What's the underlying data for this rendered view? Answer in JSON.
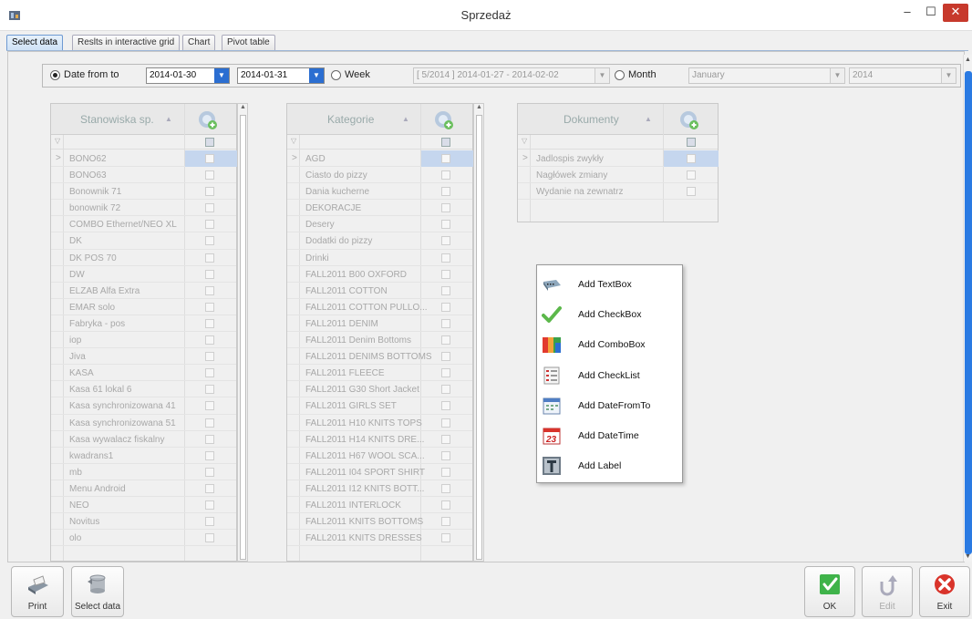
{
  "window": {
    "title": "Sprzedaż",
    "minimize": "–",
    "maximize": "☐",
    "close": "✕"
  },
  "tabs": [
    {
      "label": "Select data",
      "active": true
    },
    {
      "label": "Reslts in interactive grid",
      "active": false
    },
    {
      "label": "Chart",
      "active": false
    },
    {
      "label": "Pivot table",
      "active": false
    }
  ],
  "filter": {
    "date_from_to_label": "Date from to",
    "date_from": "2014-01-30",
    "date_to": "2014-01-31",
    "week_label": "Week",
    "week_value": "[ 5/2014 ] 2014-01-27 - 2014-02-02",
    "month_label": "Month",
    "month_value": "January",
    "year_value": "2014",
    "selected": "date_from_to"
  },
  "grids": {
    "stanowiska": {
      "header": "Stanowiska sp.",
      "rows": [
        "BONO62",
        "BONO63",
        "Bonownik 71",
        "bonownik 72",
        "COMBO Ethernet/NEO XL",
        "DK",
        "DK POS 70",
        "DW",
        "ELZAB Alfa Extra",
        "EMAR solo",
        "Fabryka - pos",
        "iop",
        "Jiva",
        "KASA",
        "Kasa 61 lokal 6",
        "Kasa synchronizowana 41",
        "Kasa synchronizowana 51",
        "Kasa wywalacz fiskalny",
        "kwadrans1",
        "mb",
        "Menu Android",
        "NEO",
        "Novitus",
        "olo"
      ]
    },
    "kategorie": {
      "header": "Kategorie",
      "rows": [
        "AGD",
        "Ciasto do pizzy",
        "Dania kucherne",
        "DEKORACJE",
        "Desery",
        "Dodatki do pizzy",
        "Drinki",
        "FALL2011 B00 OXFORD",
        "FALL2011 COTTON",
        "FALL2011 COTTON PULLO...",
        "FALL2011 DENIM",
        "FALL2011 Denim Bottoms",
        "FALL2011 DENIMS BOTTOMS",
        "FALL2011 FLEECE",
        "FALL2011 G30 Short Jacket",
        "FALL2011 GIRLS SET",
        "FALL2011 H10 KNITS TOPS",
        "FALL2011 H14 KNITS DRE...",
        "FALL2011 H67 WOOL SCA...",
        "FALL2011 I04 SPORT SHIRT",
        "FALL2011 I12 KNITS BOTT...",
        "FALL2011 INTERLOCK",
        "FALL2011 KNITS BOTTOMS",
        "FALL2011 KNITS DRESSES"
      ]
    },
    "dokumenty": {
      "header": "Dokumenty",
      "rows": [
        "Jadlospis zwykły",
        "Nagłówek zmiany",
        "Wydanie na zewnatrz"
      ]
    }
  },
  "context_menu": [
    {
      "label": "Add TextBox",
      "icon": "textbox-icon"
    },
    {
      "label": "Add CheckBox",
      "icon": "checkmark-icon"
    },
    {
      "label": "Add ComboBox",
      "icon": "combobox-icon"
    },
    {
      "label": "Add CheckList",
      "icon": "checklist-icon"
    },
    {
      "label": "Add DateFromTo",
      "icon": "calendar-icon"
    },
    {
      "label": "Add DateTime",
      "icon": "datetime-icon"
    },
    {
      "label": "Add Label",
      "icon": "label-icon"
    }
  ],
  "bottom_buttons": {
    "print": "Print",
    "select_data": "Select data",
    "ok": "OK",
    "edit": "Edit",
    "exit": "Exit"
  }
}
